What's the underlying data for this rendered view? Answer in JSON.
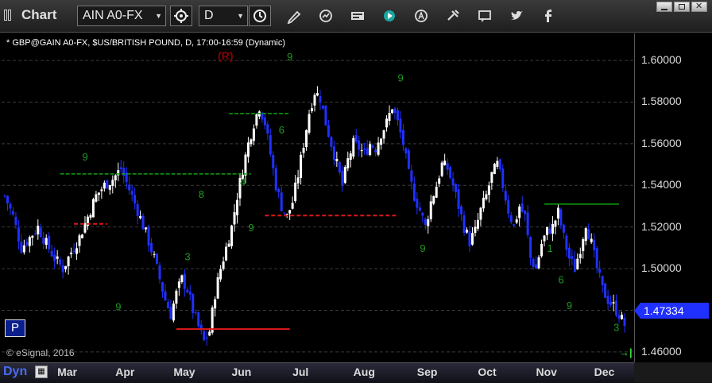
{
  "app": {
    "title": "Chart"
  },
  "toolbar": {
    "symbol": "AIN A0-FX",
    "interval": "D",
    "icons": [
      "gear-icon",
      "clock-icon",
      "pencil-icon",
      "refresh-icon",
      "news-icon",
      "play-icon",
      "analytics-icon",
      "tools-icon",
      "comment-icon",
      "twitter-icon",
      "facebook-icon"
    ]
  },
  "chart": {
    "ticker_line": "* GBP@GAIN A0-FX, $US/BRITISH POUND, D, 17:00-16:59 (Dynamic)",
    "copyright": "© eSignal, 2016",
    "reversal_label": "(R)",
    "period_button": "P",
    "current_price": "1.47334",
    "mode_label": "Dyn",
    "colors": {
      "up": "#ffffff",
      "down": "#2030ff",
      "label": "#1f9a1f",
      "green_line": "#10a010",
      "red_line": "#e01818",
      "reversal": "#8b0000"
    }
  },
  "chart_data": {
    "type": "candlestick",
    "title": "* GBP@GAIN A0-FX, $US/BRITISH POUND, D, 17:00-16:59 (Dynamic)",
    "y_ticks": [
      "1.60000",
      "1.58000",
      "1.56000",
      "1.54000",
      "1.52000",
      "1.50000",
      "1.48000",
      "1.46000"
    ],
    "ylim": [
      1.455,
      1.613
    ],
    "x_ticks": [
      "Mar",
      "Apr",
      "May",
      "Jun",
      "Jul",
      "Aug",
      "Sep",
      "Oct",
      "Nov",
      "Dec"
    ],
    "last_price": 1.47334,
    "close_path": [
      [
        0,
        1.535
      ],
      [
        3,
        1.525
      ],
      [
        6,
        1.51
      ],
      [
        9,
        1.515
      ],
      [
        12,
        1.52
      ],
      [
        15,
        1.512
      ],
      [
        18,
        1.505
      ],
      [
        21,
        1.5
      ],
      [
        24,
        1.508
      ],
      [
        27,
        1.515
      ],
      [
        30,
        1.525
      ],
      [
        33,
        1.535
      ],
      [
        36,
        1.54
      ],
      [
        39,
        1.543
      ],
      [
        42,
        1.548
      ],
      [
        45,
        1.538
      ],
      [
        48,
        1.528
      ],
      [
        51,
        1.517
      ],
      [
        54,
        1.505
      ],
      [
        56,
        1.495
      ],
      [
        58,
        1.485
      ],
      [
        60,
        1.478
      ],
      [
        62,
        1.488
      ],
      [
        64,
        1.495
      ],
      [
        66,
        1.49
      ],
      [
        68,
        1.48
      ],
      [
        70,
        1.472
      ],
      [
        72,
        1.465
      ],
      [
        74,
        1.47
      ],
      [
        76,
        1.488
      ],
      [
        78,
        1.5
      ],
      [
        80,
        1.51
      ],
      [
        82,
        1.52
      ],
      [
        84,
        1.535
      ],
      [
        86,
        1.548
      ],
      [
        88,
        1.56
      ],
      [
        90,
        1.57
      ],
      [
        92,
        1.578
      ],
      [
        94,
        1.57
      ],
      [
        96,
        1.555
      ],
      [
        98,
        1.54
      ],
      [
        100,
        1.53
      ],
      [
        102,
        1.525
      ],
      [
        104,
        1.532
      ],
      [
        106,
        1.545
      ],
      [
        108,
        1.56
      ],
      [
        110,
        1.575
      ],
      [
        112,
        1.585
      ],
      [
        114,
        1.582
      ],
      [
        116,
        1.57
      ],
      [
        118,
        1.56
      ],
      [
        120,
        1.55
      ],
      [
        122,
        1.54
      ],
      [
        124,
        1.552
      ],
      [
        126,
        1.56
      ],
      [
        128,
        1.558
      ],
      [
        130,
        1.555
      ],
      [
        132,
        1.56
      ],
      [
        134,
        1.558
      ],
      [
        136,
        1.565
      ],
      [
        138,
        1.57
      ],
      [
        140,
        1.578
      ],
      [
        142,
        1.57
      ],
      [
        144,
        1.56
      ],
      [
        146,
        1.545
      ],
      [
        148,
        1.535
      ],
      [
        150,
        1.528
      ],
      [
        152,
        1.52
      ],
      [
        154,
        1.532
      ],
      [
        156,
        1.54
      ],
      [
        158,
        1.55
      ],
      [
        160,
        1.548
      ],
      [
        162,
        1.54
      ],
      [
        164,
        1.53
      ],
      [
        166,
        1.52
      ],
      [
        168,
        1.513
      ],
      [
        170,
        1.518
      ],
      [
        172,
        1.528
      ],
      [
        174,
        1.535
      ],
      [
        176,
        1.545
      ],
      [
        178,
        1.55
      ],
      [
        180,
        1.54
      ],
      [
        182,
        1.528
      ],
      [
        184,
        1.52
      ],
      [
        186,
        1.53
      ],
      [
        188,
        1.525
      ],
      [
        190,
        1.505
      ],
      [
        192,
        1.5
      ],
      [
        194,
        1.512
      ],
      [
        196,
        1.518
      ],
      [
        198,
        1.52
      ],
      [
        200,
        1.527
      ],
      [
        202,
        1.515
      ],
      [
        204,
        1.505
      ],
      [
        206,
        1.5
      ],
      [
        208,
        1.51
      ],
      [
        210,
        1.522
      ],
      [
        212,
        1.512
      ],
      [
        214,
        1.5
      ],
      [
        216,
        1.49
      ],
      [
        218,
        1.485
      ],
      [
        220,
        1.482
      ],
      [
        222,
        1.478
      ],
      [
        224,
        1.473
      ]
    ],
    "n_days": 225,
    "annotations": {
      "green_levels": [
        {
          "value": 1.5455,
          "from_day": 20,
          "to_day": 89
        },
        {
          "value": 1.5745,
          "from_day": 81,
          "to_day": 103
        },
        {
          "value": 1.531,
          "from_day": 195,
          "to_day": 222
        }
      ],
      "red_levels": [
        {
          "value": 1.5215,
          "from_day": 25,
          "to_day": 37
        },
        {
          "value": 1.5255,
          "from_day": 94,
          "to_day": 142
        },
        {
          "value": 1.471,
          "from_day": 62,
          "to_day": 103
        }
      ],
      "green_numbers": [
        {
          "day": 28,
          "value": 1.552,
          "text": "9"
        },
        {
          "day": 40,
          "value": 1.48,
          "text": "9"
        },
        {
          "day": 88,
          "value": 1.518,
          "text": "9"
        },
        {
          "day": 102,
          "value": 1.6,
          "text": "9"
        },
        {
          "day": 142,
          "value": 1.59,
          "text": "9"
        },
        {
          "day": 150,
          "value": 1.508,
          "text": "9"
        },
        {
          "day": 203,
          "value": 1.4805,
          "text": "9"
        },
        {
          "day": 220,
          "value": 1.47,
          "text": "3"
        },
        {
          "day": 65,
          "value": 1.504,
          "text": "3"
        },
        {
          "day": 70,
          "value": 1.534,
          "text": "8"
        },
        {
          "day": 85,
          "value": 1.54,
          "text": "4"
        },
        {
          "day": 99,
          "value": 1.565,
          "text": "6"
        },
        {
          "day": 196,
          "value": 1.508,
          "text": "1"
        },
        {
          "day": 200,
          "value": 1.493,
          "text": "6"
        }
      ]
    }
  }
}
